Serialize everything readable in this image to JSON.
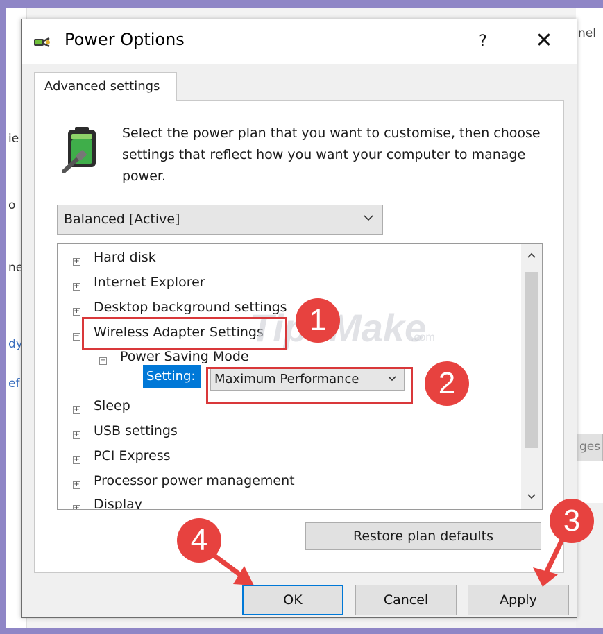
{
  "background": {
    "fragments": [
      {
        "text": "nel"
      },
      {
        "text": "ie"
      },
      {
        "text": "o"
      },
      {
        "text": "ne"
      },
      {
        "text": "dy"
      },
      {
        "text": "ef"
      }
    ],
    "right_button_label": "ges"
  },
  "dialog": {
    "title": "Power Options",
    "help_label": "?",
    "close_label": "✕",
    "tab_label": "Advanced settings",
    "intro": "Select the power plan that you want to customise, then choose settings that reflect how you want your computer to manage power.",
    "plan_select_value": "Balanced [Active]",
    "tree_items": [
      {
        "label": "Hard disk",
        "expander": "+"
      },
      {
        "label": "Internet Explorer",
        "expander": "+"
      },
      {
        "label": "Desktop background settings",
        "expander": "+"
      },
      {
        "label": "Wireless Adapter Settings",
        "expander": "−"
      },
      {
        "label": "Power Saving Mode",
        "expander": "−"
      },
      {
        "label": "Sleep",
        "expander": "+"
      },
      {
        "label": "USB settings",
        "expander": "+"
      },
      {
        "label": "PCI Express",
        "expander": "+"
      },
      {
        "label": "Processor power management",
        "expander": "+"
      },
      {
        "label": "Display",
        "expander": "+"
      }
    ],
    "setting_label": "Setting:",
    "setting_value": "Maximum Performance",
    "restore_label": "Restore plan defaults",
    "ok_label": "OK",
    "cancel_label": "Cancel",
    "apply_label": "Apply"
  },
  "annotations": {
    "badges": [
      "1",
      "2",
      "3",
      "4"
    ],
    "watermark": "TipsMake",
    "watermark_sub": ".com",
    "color": "#e7423f"
  },
  "icons": {
    "title": "power-options-icon",
    "plan": "battery-plug-icon",
    "chevron": "chevron-down-icon"
  }
}
